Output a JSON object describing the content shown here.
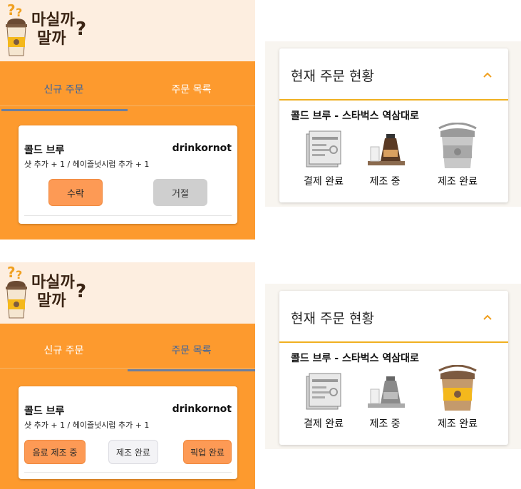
{
  "brand": {
    "logo_line1": "마실까",
    "logo_line2": "말까",
    "logo_q": "?"
  },
  "panel_top": {
    "tabs": [
      {
        "label": "신규 주문",
        "active": true
      },
      {
        "label": "주문 목록",
        "active": false
      }
    ],
    "order": {
      "name": "콜드 브루",
      "user": "drinkornot",
      "options": "샷 추가 + 1 / 헤이즐넛시럽 추가 + 1",
      "buttons": [
        "수락",
        "거절"
      ]
    }
  },
  "panel_bottom": {
    "tabs": [
      {
        "label": "신규 주문",
        "active": false
      },
      {
        "label": "주문 목록",
        "active": true
      }
    ],
    "order": {
      "name": "콜드 브루",
      "user": "drinkornot",
      "options": "샷 추가 + 1 / 헤이즐넛시럽 추가 + 1",
      "buttons": [
        "음료 제조 중",
        "제조 완료",
        "픽업 완료"
      ]
    }
  },
  "status_top": {
    "title": "현재 주문 현황",
    "store": "콜드 브루 - 스타벅스 역삼대로",
    "stages": [
      "결제 완료",
      "제조 중",
      "제조 완료"
    ],
    "current_stage": "제조 중"
  },
  "status_bottom": {
    "title": "현재 주문 현황",
    "store": "콜드 브루 - 스타벅스 역삼대로",
    "stages": [
      "결제 완료",
      "제조 중",
      "제조 완료"
    ],
    "current_stage": "제조 완료"
  },
  "colors": {
    "accent": "#fd9a2e",
    "header_bg": "#fdeee0",
    "status_line": "#f0b020",
    "active_tab": "#3a64a0"
  }
}
